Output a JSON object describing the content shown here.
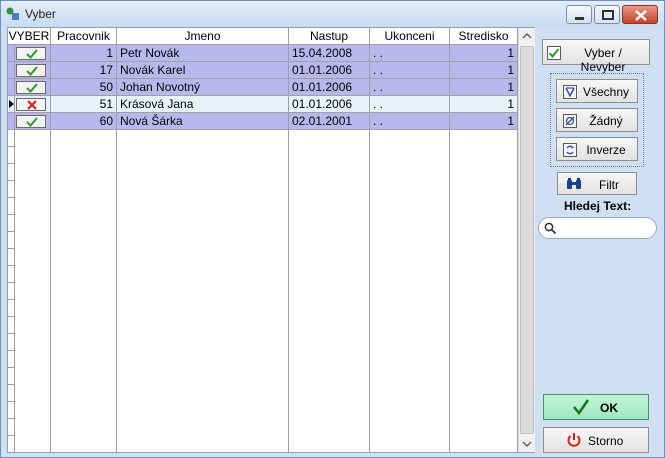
{
  "window": {
    "title": "Vyber"
  },
  "grid": {
    "columns": [
      "VYBER",
      "Pracovnik",
      "Jmeno",
      "Nastup",
      "Ukonceni",
      "Stredisko"
    ],
    "rows": [
      {
        "selected": true,
        "pracovnik": "1",
        "jmeno": "Petr Novák",
        "nastup": "15.04.2008",
        "ukonceni": ". .",
        "stredisko": "1"
      },
      {
        "selected": true,
        "pracovnik": "17",
        "jmeno": "Novák Karel",
        "nastup": "01.01.2006",
        "ukonceni": ". .",
        "stredisko": "1"
      },
      {
        "selected": true,
        "pracovnik": "50",
        "jmeno": "Johan Novotný",
        "nastup": "01.01.2006",
        "ukonceni": ". .",
        "stredisko": "1"
      },
      {
        "selected": false,
        "pracovnik": "51",
        "jmeno": "Krásová Jana",
        "nastup": "01.01.2006",
        "ukonceni": ". .",
        "stredisko": "1"
      },
      {
        "selected": true,
        "pracovnik": "60",
        "jmeno": "Nová Šárka",
        "nastup": "02.01.2001",
        "ukonceni": ". .",
        "stredisko": "1"
      }
    ]
  },
  "side": {
    "toggle_label": "Vyber / Nevyber",
    "all_label": "Všechny",
    "none_label": "Žádný",
    "invert_label": "Inverze",
    "filter_label": "Filtr",
    "search_label": "Hledej Text:",
    "search_value": "",
    "ok_label": "OK",
    "cancel_label": "Storno"
  },
  "colors": {
    "selected_row": "#b8b8ee",
    "current_row": "#e8f2fb",
    "check_green": "#2a9a2a",
    "cross_red": "#d21e1e",
    "ok_bg": "#9fe6c0",
    "power_red": "#e02020"
  }
}
